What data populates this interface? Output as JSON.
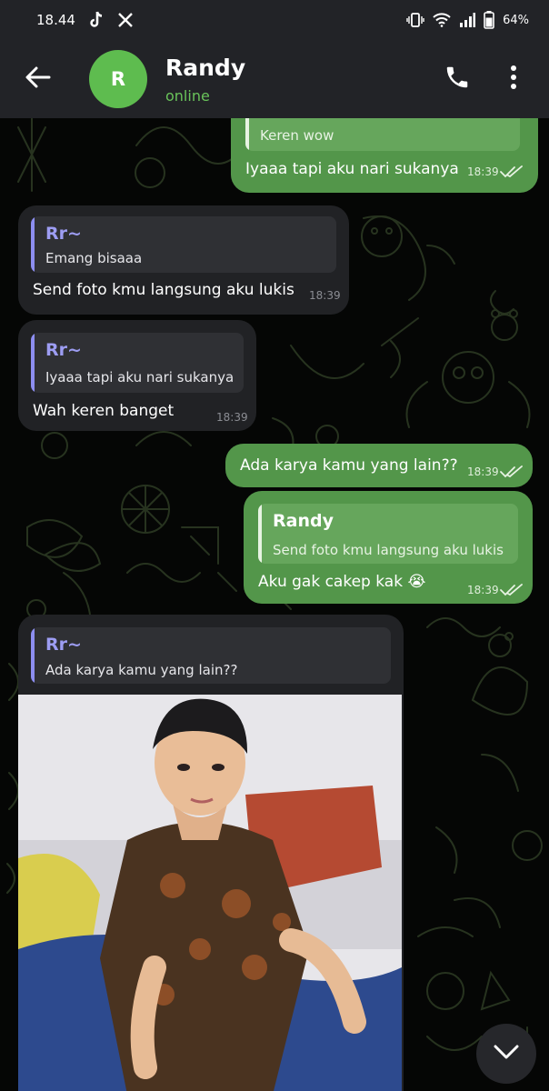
{
  "status_bar": {
    "time": "18.44",
    "battery": "64%",
    "icons": [
      "tiktok-icon",
      "x-icon",
      "vibrate-icon",
      "wifi-icon",
      "signal-icon",
      "battery-icon"
    ]
  },
  "header": {
    "avatar_letter": "R",
    "name": "Randy",
    "status": "online",
    "icons": [
      "back-arrow-icon",
      "phone-icon",
      "more-vertical-icon"
    ]
  },
  "colors": {
    "outgoing_bubble": "#53964a",
    "incoming_bubble": "#212225",
    "accent_green": "#5ebc4f",
    "quote_name_incoming": "#9d9df3",
    "header_bg": "#222327"
  },
  "messages": [
    {
      "direction": "out",
      "quote_text": "Keren wow",
      "text": "Iyaaa tapi aku nari sukanya",
      "time": "18:39",
      "read": true
    },
    {
      "direction": "in",
      "quote_name": "Rr~",
      "quote_text": "Emang bisaaa",
      "text": "Send foto kmu langsung aku lukis",
      "time": "18:39"
    },
    {
      "direction": "in",
      "quote_name": "Rr~",
      "quote_text": "Iyaaa tapi aku nari sukanya",
      "text": "Wah keren banget",
      "time": "18:39"
    },
    {
      "direction": "out",
      "text": "Ada karya kamu yang lain??",
      "time": "18:39",
      "read": true
    },
    {
      "direction": "out",
      "quote_name": "Randy",
      "quote_text": "Send foto kmu langsung aku lukis",
      "text": "Aku gak cakep kak 😭",
      "time": "18:39",
      "read": true
    },
    {
      "direction": "in",
      "quote_name": "Rr~",
      "quote_text": "Ada karya kamu yang lain??",
      "attachment": "photo"
    }
  ]
}
